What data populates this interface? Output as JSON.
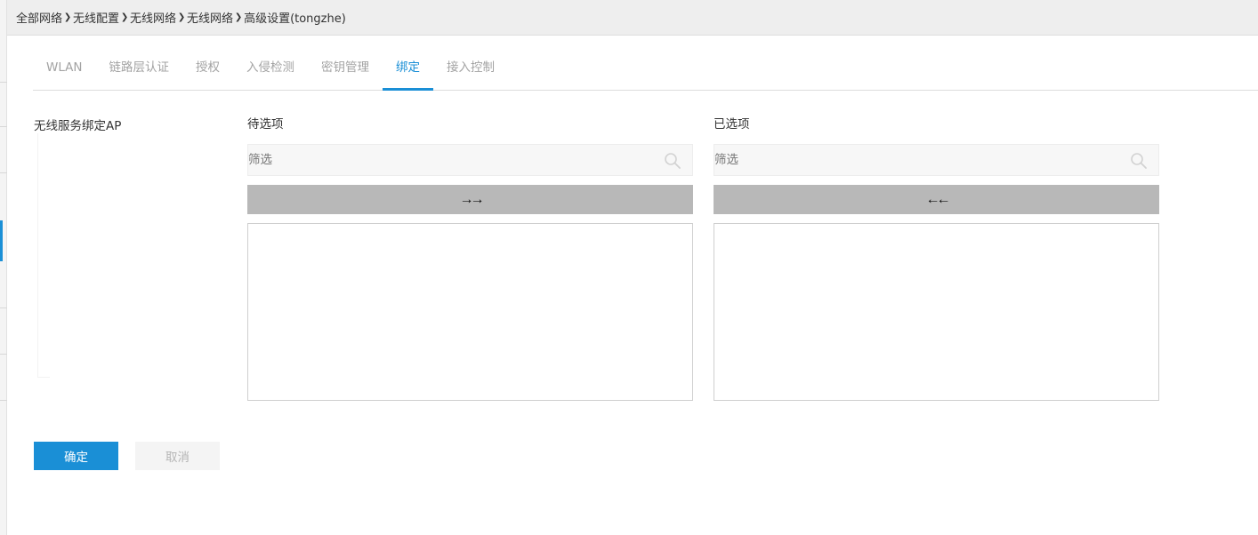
{
  "breadcrumb": {
    "items": [
      "全部网络",
      "无线配置",
      "无线网络",
      "无线网络"
    ],
    "current": "高级设置(tongzhe)"
  },
  "tabs": [
    {
      "label": "WLAN",
      "active": false
    },
    {
      "label": "链路层认证",
      "active": false
    },
    {
      "label": "授权",
      "active": false
    },
    {
      "label": "入侵检测",
      "active": false
    },
    {
      "label": "密钥管理",
      "active": false
    },
    {
      "label": "绑定",
      "active": true
    },
    {
      "label": "接入控制",
      "active": false
    }
  ],
  "form": {
    "field_label": "无线服务绑定AP",
    "available": {
      "title": "待选项",
      "filter_placeholder": "筛选",
      "move_label": "→→"
    },
    "selected": {
      "title": "已选项",
      "filter_placeholder": "筛选",
      "move_label": "←←"
    }
  },
  "actions": {
    "confirm_label": "确定",
    "cancel_label": "取消"
  },
  "colors": {
    "accent": "#1a8fd6",
    "move_button_bg": "#b8b8b8",
    "breadcrumb_bg": "#eeeeee"
  },
  "icons": {
    "breadcrumb_separator": "chevron-right-icon",
    "filter": "search-icon"
  }
}
